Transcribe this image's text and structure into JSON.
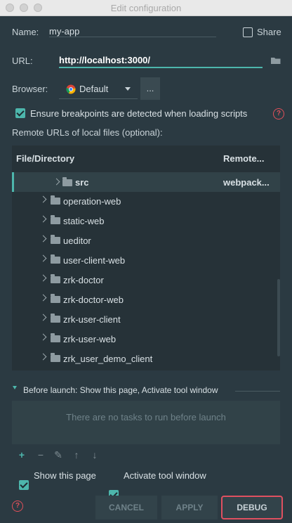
{
  "window": {
    "title": "Edit configuration"
  },
  "form": {
    "name_label": "Name:",
    "name_value": "my-app",
    "share_label": "Share",
    "url_label": "URL:",
    "url_value": "http://localhost:3000/",
    "browser_label": "Browser:",
    "browser_value": "Default",
    "more_button_label": "...",
    "breakpoints_label": "Ensure breakpoints are detected when loading scripts",
    "remote_urls_label": "Remote URLs of local files (optional):"
  },
  "table": {
    "headers": [
      "File/Directory",
      "Remote..."
    ],
    "rows": [
      {
        "name": "src",
        "remote": "webpack..."
      },
      {
        "name": "operation-web",
        "remote": ""
      },
      {
        "name": "static-web",
        "remote": ""
      },
      {
        "name": "ueditor",
        "remote": ""
      },
      {
        "name": "user-client-web",
        "remote": ""
      },
      {
        "name": "zrk-doctor",
        "remote": ""
      },
      {
        "name": "zrk-doctor-web",
        "remote": ""
      },
      {
        "name": "zrk-user-client",
        "remote": ""
      },
      {
        "name": "zrk-user-web",
        "remote": ""
      },
      {
        "name": "zrk_user_demo_client",
        "remote": ""
      }
    ]
  },
  "before_launch": {
    "label": "Before launch: Show this page, Activate tool window",
    "empty_message": "There are no tasks to run before launch",
    "show_page_label": "Show this page",
    "activate_tool_label": "Activate tool window"
  },
  "buttons": {
    "cancel": "CANCEL",
    "apply": "APPLY",
    "debug": "DEBUG"
  },
  "colors": {
    "accent": "#4db6ac",
    "danger": "#e05060",
    "background": "#2b3a42"
  }
}
